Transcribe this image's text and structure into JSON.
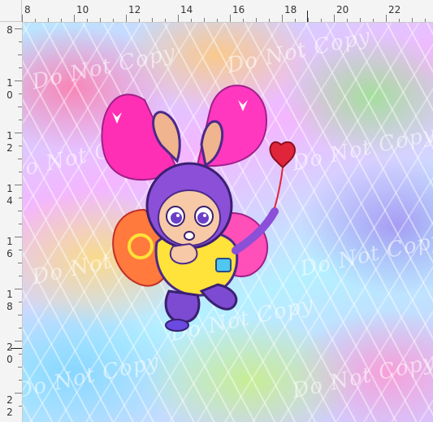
{
  "ruler_top": {
    "labels": [
      "8",
      "10",
      "12",
      "14",
      "16",
      "18",
      "20",
      "22"
    ]
  },
  "ruler_left": {
    "labels": [
      [
        "8"
      ],
      [
        "1",
        "0"
      ],
      [
        "1",
        "2"
      ],
      [
        "1",
        "4"
      ],
      [
        "1",
        "6"
      ],
      [
        "1",
        "8"
      ],
      [
        "2",
        "0"
      ],
      [
        "2",
        "2"
      ]
    ]
  },
  "watermark": {
    "text": "Do Not Copy"
  },
  "colors": {
    "ruler_bg": "#f4f4f4",
    "character_fur": "#8b4fd8",
    "wings": "#ff2fb5",
    "shirt": "#ffe23a",
    "pants": "#7c4bd2"
  }
}
